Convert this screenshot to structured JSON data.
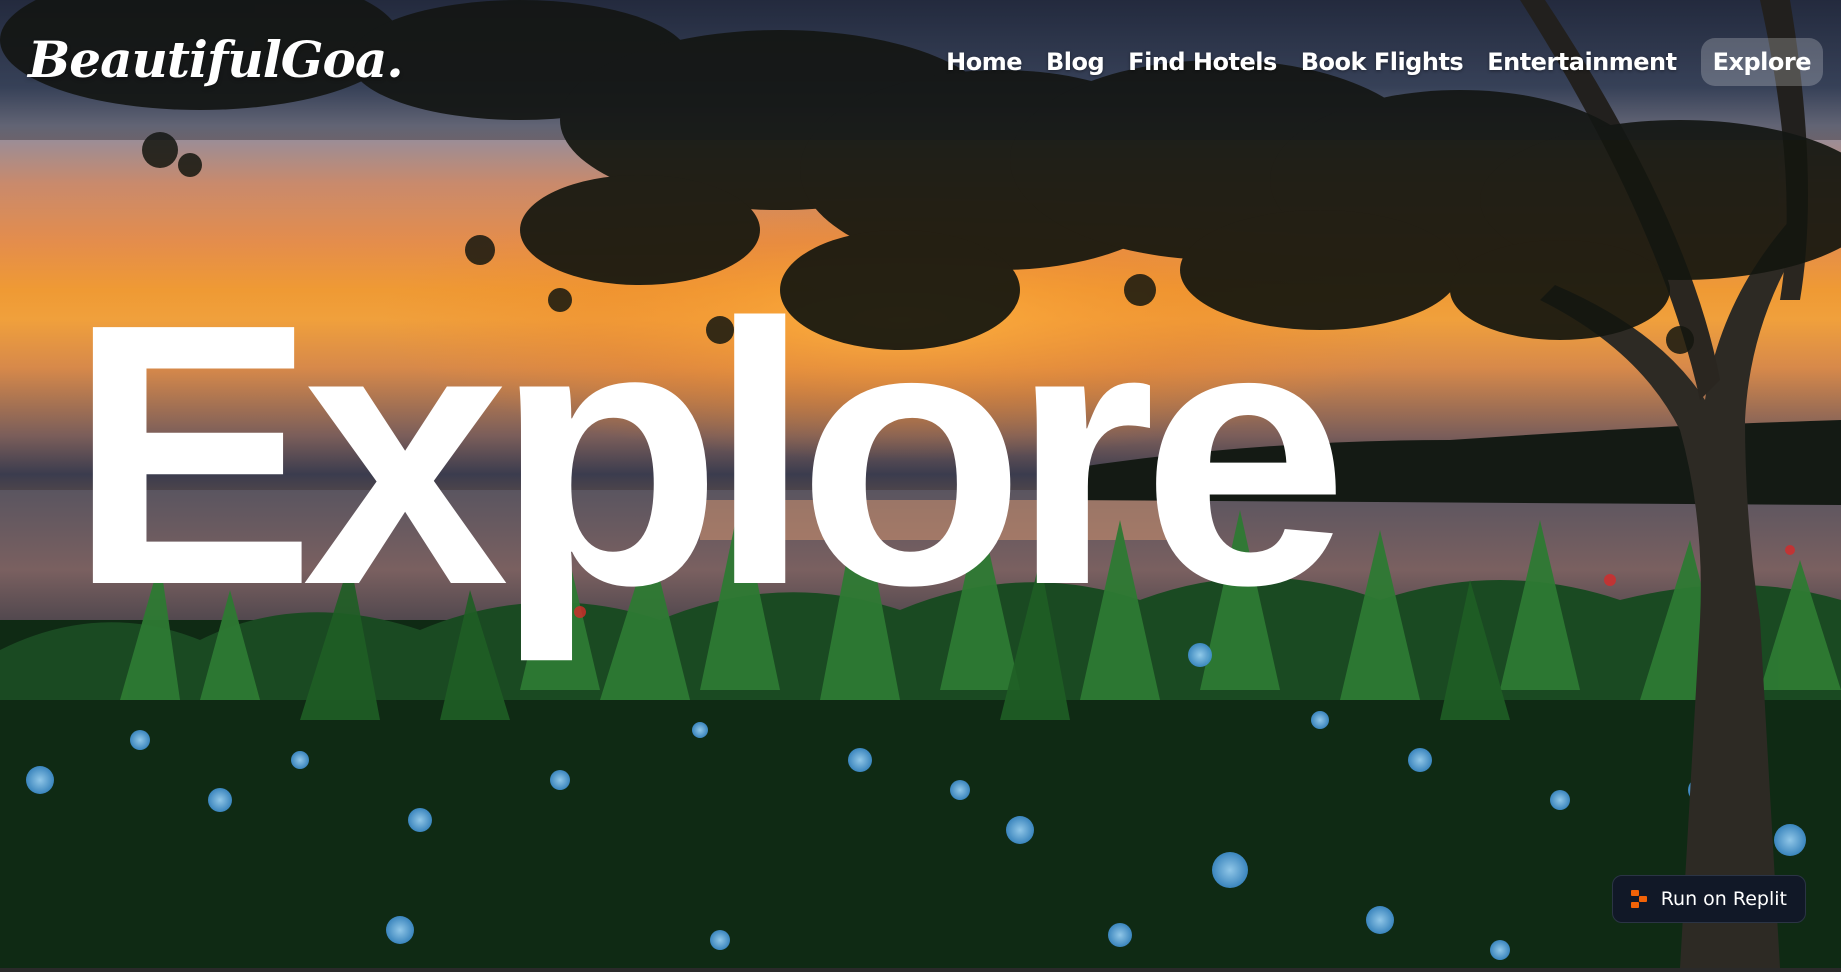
{
  "brand": {
    "logo_text": "BeautifulGoa."
  },
  "nav": {
    "items": [
      {
        "label": "Home"
      },
      {
        "label": "Blog"
      },
      {
        "label": "Find Hotels"
      },
      {
        "label": "Book Flights"
      },
      {
        "label": "Entertainment"
      }
    ],
    "explore_button": "Explore"
  },
  "hero": {
    "headline": "Explore",
    "background_scene": "sunset-over-goa-beach-with-tree-and-flowers"
  },
  "replit": {
    "label": "Run on Replit",
    "icon": "replit-icon"
  },
  "colors": {
    "text": "#ffffff",
    "replit_bg": "#111827",
    "replit_accent": "#f26207"
  }
}
